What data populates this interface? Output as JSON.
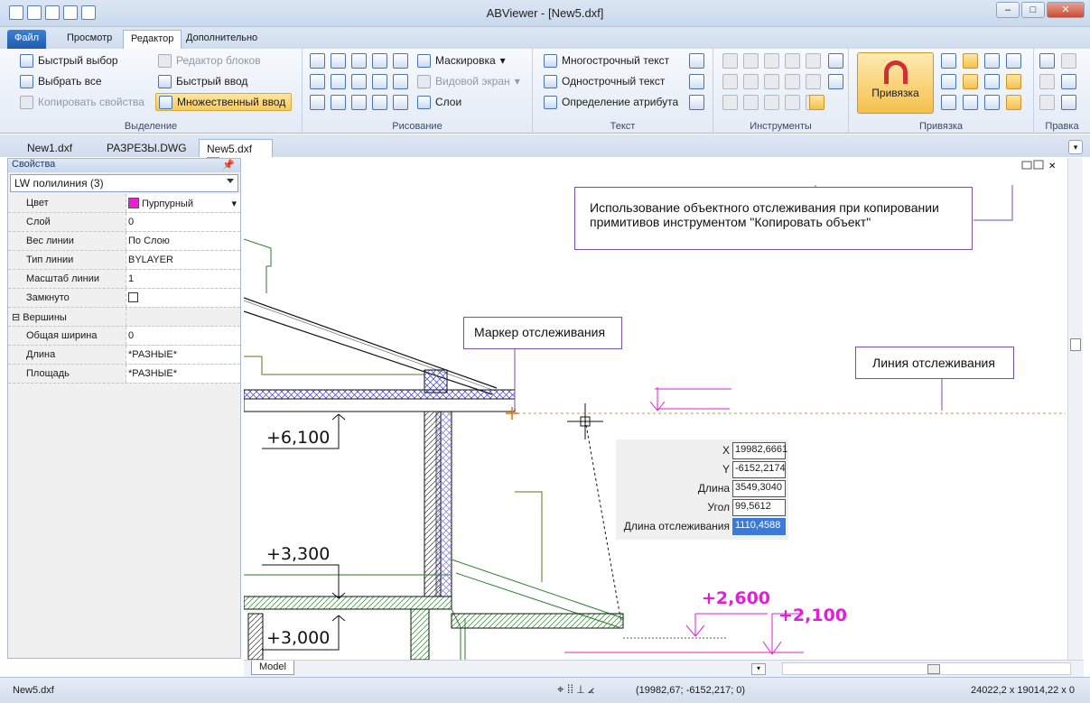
{
  "app": {
    "title": "ABViewer   - [New5.dxf]"
  },
  "ribbon_tabs": [
    "Файл",
    "Просмотр",
    "Редактор",
    "Дополнительно"
  ],
  "groups": {
    "selection": {
      "title": "Выделение",
      "quick_select": "Быстрый выбор",
      "select_all": "Выбрать все",
      "copy_props": "Копировать свойства",
      "block_editor": "Редактор блоков",
      "quick_input": "Быстрый ввод",
      "multi_input": "Множественный ввод"
    },
    "drawing": {
      "title": "Рисование",
      "masking": "Маскировка",
      "viewport": "Видовой экран",
      "layers": "Слои"
    },
    "text": {
      "title": "Текст",
      "mtext": "Многострочный текст",
      "stext": "Однострочный текст",
      "attdef": "Определение атрибута"
    },
    "tools": {
      "title": "Инструменты"
    },
    "snap": {
      "title": "Привязка",
      "big_button": "Привязка"
    },
    "edit": {
      "title": "Правка"
    }
  },
  "doc_tabs": [
    "New1.dxf",
    "РАЗРЕЗЫ.DWG",
    "New5.dxf"
  ],
  "props": {
    "panel_title": "Свойства",
    "object": "LW полилиния (3)",
    "rows": [
      {
        "name": "Цвет",
        "value": "Пурпурный"
      },
      {
        "name": "Слой",
        "value": "0"
      },
      {
        "name": "Вес линии",
        "value": "По Слою"
      },
      {
        "name": "Тип линии",
        "value": "BYLAYER"
      },
      {
        "name": "Масштаб линии",
        "value": "1"
      },
      {
        "name": "Замкнуто",
        "value": ""
      },
      {
        "name": "Вершины",
        "value": ""
      },
      {
        "name": "Общая ширина",
        "value": "0"
      },
      {
        "name": "Длина",
        "value": "*РАЗНЫЕ*"
      },
      {
        "name": "Площадь",
        "value": "*РАЗНЫЕ*"
      }
    ]
  },
  "callouts": {
    "tracking_copy": "Использование объектного отслеживания при копировании примитивов инструментом \"Копировать объект\"",
    "marker": "Маркер отслеживания",
    "line": "Линия отслеживания"
  },
  "coords": {
    "x_label": "X",
    "x": "19982,6661",
    "y_label": "Y",
    "y": "-6152,2174",
    "len_label": "Длина",
    "len": "3549,3040",
    "angle_label": "Угол",
    "angle": "99,5612",
    "track_label": "Длина отслеживания",
    "track": "1110,4588"
  },
  "levels": {
    "l1": "+6,100",
    "l2": "+3,300",
    "l3": "+3,000",
    "p1": "+2,600",
    "p2": "+2,100"
  },
  "model_tab": "Model",
  "status": {
    "file": "New5.dxf",
    "coords": "(19982,67; -6152,217; 0)",
    "size": "24022,2 x 19014,22 x 0"
  },
  "colors": {
    "accent": "#1f5cb0",
    "magenta": "#e21fd6",
    "callout_border": "#7b4fa5"
  }
}
